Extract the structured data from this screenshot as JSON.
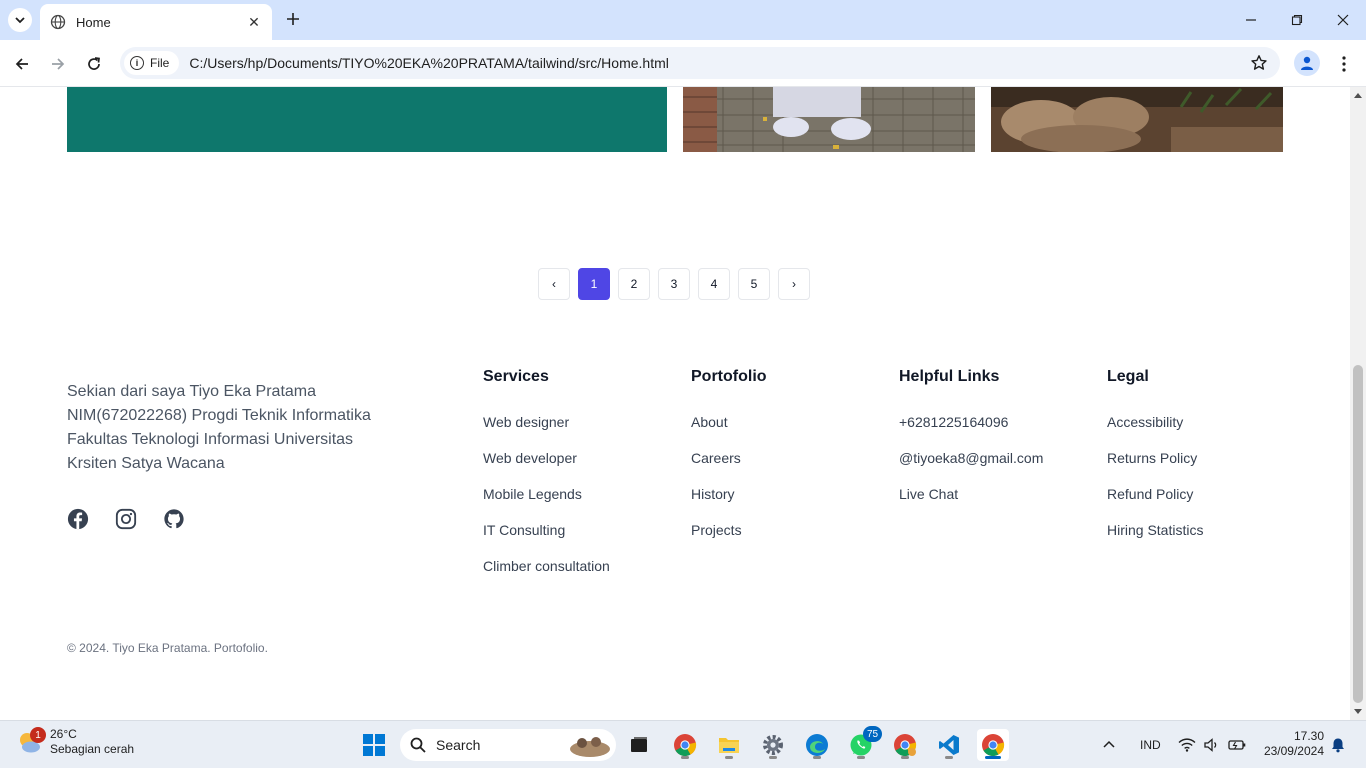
{
  "browser": {
    "tab_title": "Home",
    "new_tab_symbol": "+",
    "close_symbol": "✕",
    "security_chip": "File",
    "url": "C:/Users/hp/Documents/TIYO%20EKA%20PRATAMA/tailwind/src/Home.html"
  },
  "pagination": {
    "prev": "‹",
    "pages": [
      "1",
      "2",
      "3",
      "4",
      "5"
    ],
    "active": "1",
    "next": "›"
  },
  "footer": {
    "about": "Sekian dari saya Tiyo Eka Pratama NIM(672022268) Progdi Teknik Informatika Fakultas Teknologi Informasi Universitas Krsiten Satya Wacana",
    "socials": [
      "facebook-icon",
      "instagram-icon",
      "github-icon"
    ],
    "columns": [
      {
        "title": "Services",
        "links": [
          "Web designer",
          "Web developer",
          "Mobile Legends",
          "IT Consulting",
          "Climber consultation"
        ]
      },
      {
        "title": "Portofolio",
        "links": [
          "About",
          "Careers",
          "History",
          "Projects"
        ]
      },
      {
        "title": "Helpful Links",
        "links": [
          "+6281225164096",
          "@tiyoeka8@gmail.com",
          "Live Chat"
        ]
      },
      {
        "title": "Legal",
        "links": [
          "Accessibility",
          "Returns Policy",
          "Refund Policy",
          "Hiring Statistics"
        ]
      }
    ],
    "copyright": "© 2024. Tiyo Eka Pratama. Portofolio."
  },
  "taskbar": {
    "weather_temp": "26°C",
    "weather_desc": "Sebagian cerah",
    "weather_badge": "1",
    "search_label": "Search",
    "whatsapp_badge": "75",
    "language": "IND",
    "time": "17.30",
    "date": "23/09/2024"
  },
  "colors": {
    "accent": "#4f46e5",
    "green_block": "#0e776c",
    "tabstrip": "#d3e3fd"
  }
}
